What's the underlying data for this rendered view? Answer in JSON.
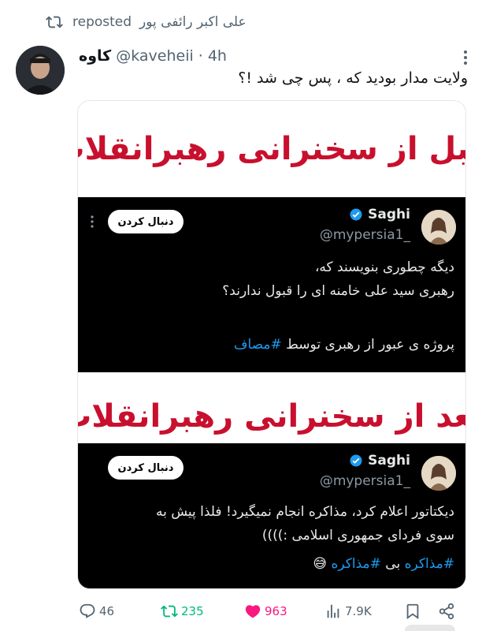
{
  "repost": {
    "name": "علی اکبر رائفی پور",
    "label": "reposted"
  },
  "tweet": {
    "author_name": "کاوه",
    "handle": "@kaveheii",
    "separator": "·",
    "time": "4h",
    "text": "ولایت مدار بودید که ، پس چی شد !؟"
  },
  "media": {
    "banner_before": "قبل از سخنرانی رهبرانقلاب",
    "banner_after": "بعد از سخنرانی رهبرانقلاب",
    "tweet1": {
      "name": "Saghi",
      "handle": "@mypersia1_",
      "follow": "دنبال کردن",
      "line1": "دیگه چطوری بنویسند که،",
      "line2": "رهبری سید علی خامنه ای را قبول ندارند؟",
      "line3_text": "پروژه ی عبور از رهبری توسط ",
      "line3_tag": "#مصاف"
    },
    "tweet2": {
      "name": "Saghi",
      "handle": "@mypersia1_",
      "follow": "دنبال کردن",
      "line1": "دیکتاتور اعلام کرد، مذاکره انجام نمیگیرد! فلذا پیش به",
      "line2": "سوی فردای جمهوری اسلامی :))))",
      "line3_tag1": "#مذاکره",
      "line3_mid": " بی ",
      "line3_tag2": "#مذاکره",
      "line3_emoji": "😅"
    }
  },
  "actions": {
    "replies": "46",
    "reposts": "235",
    "likes": "963",
    "views": "7.9K"
  },
  "colors": {
    "repost_green": "#00ba7c",
    "like_pink": "#f91880",
    "banner_red": "#c8102e",
    "link_blue": "#1d9bf0"
  },
  "icons": [
    "repost-icon",
    "more-icon",
    "verified-icon",
    "reply-icon",
    "like-icon",
    "views-icon",
    "bookmark-icon",
    "share-icon"
  ]
}
